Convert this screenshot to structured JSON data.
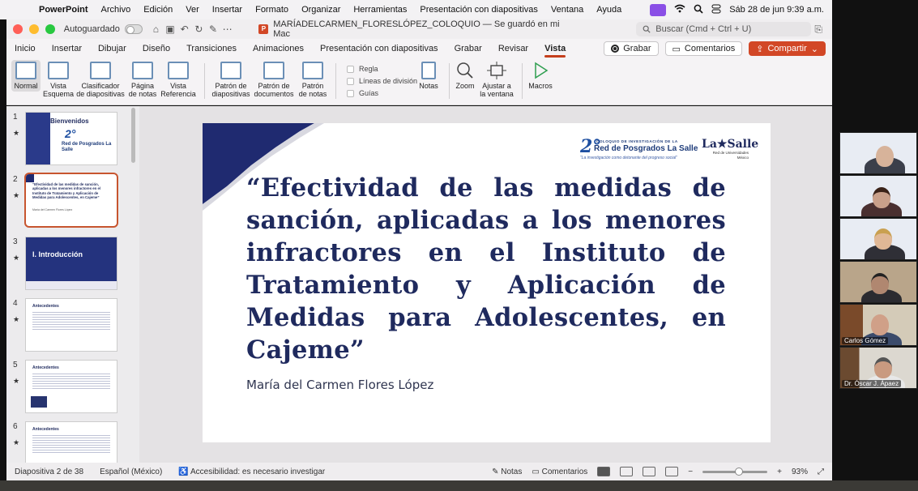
{
  "menubar": {
    "app": "PowerPoint",
    "items": [
      "Archivo",
      "Edición",
      "Ver",
      "Insertar",
      "Formato",
      "Organizar",
      "Herramientas",
      "Presentación con diapositivas",
      "Ventana",
      "Ayuda"
    ],
    "datetime": "Sáb 28 de jun  9:39 a.m."
  },
  "titlebar": {
    "autosave_label": "Autoguardado",
    "document_title": "MARÍADELCARMEN_FLORESLÓPEZ_COLOQUIO — Se guardó en mi Mac",
    "search_placeholder": "Buscar (Cmd + Ctrl + U)"
  },
  "ribbon_tabs": {
    "items": [
      "Inicio",
      "Insertar",
      "Dibujar",
      "Diseño",
      "Transiciones",
      "Animaciones",
      "Presentación con diapositivas",
      "Grabar",
      "Revisar",
      "Vista"
    ],
    "active": "Vista",
    "record_label": "Grabar",
    "comments_label": "Comentarios",
    "share_label": "Compartir"
  },
  "ribbon": {
    "normal": "Normal",
    "outline": [
      "Vista",
      "Esquema"
    ],
    "sorter": [
      "Clasificador",
      "de diapositivas"
    ],
    "notes_page": [
      "Página",
      "de notas"
    ],
    "reading": [
      "Vista",
      "Referencia"
    ],
    "slide_master": [
      "Patrón de",
      "diapositivas"
    ],
    "handout_master": [
      "Patrón de",
      "documentos"
    ],
    "notes_master": [
      "Patrón",
      "de notas"
    ],
    "ruler": "Regla",
    "gridlines": "Líneas de división",
    "guides": "Guías",
    "notes": "Notas",
    "zoom": "Zoom",
    "fit": [
      "Ajustar a",
      "la ventana"
    ],
    "macros": "Macros"
  },
  "thumbnails": [
    {
      "num": "1",
      "label": "Bienvenidos",
      "kind": "welcome"
    },
    {
      "num": "2",
      "label": "“Efectividad de las medidas de sanción, aplicadas a los menores infractores en el Instituto de Tratamiento y Aplicación de Medidas para Adolescentes, en Cajeme”",
      "kind": "title"
    },
    {
      "num": "3",
      "label": "I. Introducción",
      "kind": "section"
    },
    {
      "num": "4",
      "label": "Antecedentes",
      "kind": "text"
    },
    {
      "num": "5",
      "label": "Antecedentes",
      "kind": "text"
    },
    {
      "num": "6",
      "label": "Antecedentes",
      "kind": "text"
    }
  ],
  "slide": {
    "title": "“Efectividad de las medidas de sanción, aplicadas a los menores infractores en el Instituto de Tratamiento y Aplicación de Medidas para Adolescentes, en Cajeme”",
    "author": "María del Carmen Flores López",
    "logo_number": "2°",
    "logo_small": "COLOQUIO DE INVESTIGACIÓN DE LA",
    "logo_network": "Red de Posgrados La Salle",
    "logo_tagline": "“La investigación como detonante del progreso social”",
    "lasalle": "La★Salle",
    "lasalle_sub": [
      "Red de Universidades",
      "México"
    ]
  },
  "status": {
    "slide_info": "Diapositiva 2 de 38",
    "language": "Español (México)",
    "accessibility": "Accesibilidad: es necesario investigar",
    "notes": "Notas",
    "comments": "Comentarios",
    "zoom": "93%"
  },
  "participants": [
    {
      "name": ""
    },
    {
      "name": ""
    },
    {
      "name": ""
    },
    {
      "name": ""
    },
    {
      "name": "Carlos Gómez"
    },
    {
      "name": "Dr. Óscar J. Ápaez"
    }
  ],
  "colors": {
    "accent": "#c43e1c",
    "share": "#d24726",
    "slide_title": "#1f2a5e",
    "slide_corner": "#1f2a70"
  }
}
